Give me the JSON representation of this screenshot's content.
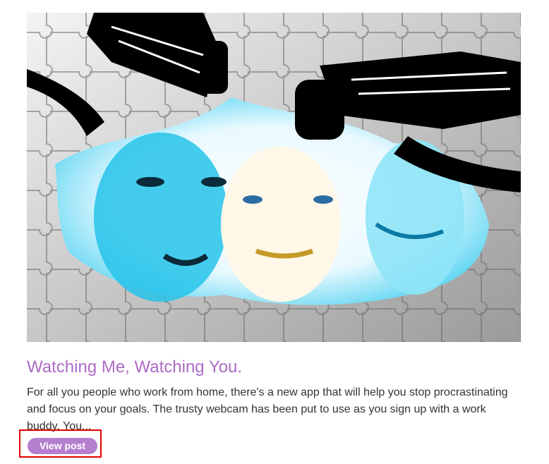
{
  "post": {
    "title": "Watching Me, Watching You.",
    "excerpt": "For all you people who work from home, there's a new app that will help you stop procrastinating and focus on your goals. The trusty webcam has been put to use as you sign up with a work buddy. You...",
    "button_label": "View post",
    "image_alt": ""
  },
  "colors": {
    "title": "#ad6bc6",
    "button_bg": "#b57fd0",
    "highlight_border": "#e30000"
  }
}
